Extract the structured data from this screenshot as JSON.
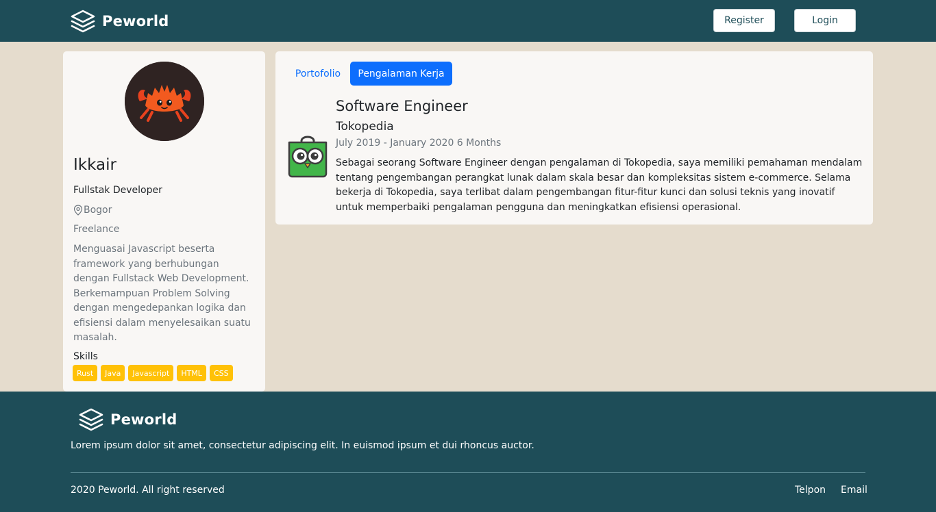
{
  "navbar": {
    "brand": "Peworld",
    "register_label": "Register",
    "login_label": "Login"
  },
  "profile": {
    "name": "Ikkair",
    "job": "Fullstak Developer",
    "location": "Bogor",
    "work_type": "Freelance",
    "description": "Menguasai Javascript beserta framework yang berhubungan dengan Fullstack Web Development. Berkemampuan Problem Solving dengan mengedepankan logika dan efisiensi dalam menyelesaikan suatu masalah.",
    "skills_title": "Skills",
    "skills": [
      "Rust",
      "Java",
      "Javascript",
      "HTML",
      "CSS"
    ]
  },
  "tabs": {
    "portfolio": "Portofolio",
    "experience": "Pengalaman Kerja",
    "active": "experience"
  },
  "experience": {
    "position": "Software Engineer",
    "company": "Tokopedia",
    "date": "July 2019 - January 2020 6 Months",
    "description": "Sebagai seorang Software Engineer dengan pengalaman di Tokopedia, saya memiliki pemahaman mendalam tentang pengembangan perangkat lunak dalam skala besar dan kompleksitas sistem e-commerce. Selama bekerja di Tokopedia, saya terlibat dalam pengembangan fitur-fitur kunci dan solusi teknis yang inovatif untuk memperbaiki pengalaman pengguna dan meningkatkan efisiensi operasional."
  },
  "footer": {
    "brand": "Peworld",
    "description": "Lorem ipsum dolor sit amet, consectetur adipiscing elit. In euismod ipsum et dui rhoncus auctor.",
    "copyright": "2020 Peworld. All right reserved",
    "telpon": "Telpon",
    "email": "Email"
  },
  "icons": {
    "brand": "layers-icon",
    "location": "map-pin-icon",
    "avatar": "crab-mascot-avatar",
    "company_logo": "tokopedia-logo"
  },
  "colors": {
    "primary_dark": "#1e4d58",
    "page_bg": "#e5dccd",
    "card_bg": "#f9f7f5",
    "accent_blue": "#0d6efd",
    "skill_yellow": "#ffc107"
  }
}
